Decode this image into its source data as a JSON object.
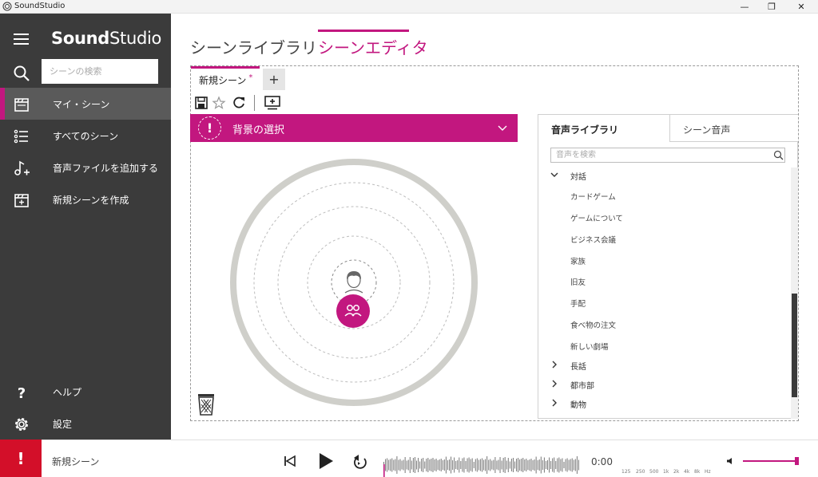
{
  "window": {
    "title": "SoundStudio",
    "controls": {
      "minimize": "—",
      "maximize": "❐",
      "close": "✕"
    }
  },
  "sidebar": {
    "brand_bold": "Sound",
    "brand_rest": "Studio",
    "search_placeholder": "シーンの検索",
    "items": [
      {
        "label": "マイ・シーン",
        "icon": "clapperboard-icon",
        "active": true
      },
      {
        "label": "すべてのシーン",
        "icon": "list-icon"
      },
      {
        "label": "音声ファイルを追加する",
        "icon": "add-music-icon"
      },
      {
        "label": "新規シーンを作成",
        "icon": "new-scene-icon"
      }
    ],
    "bottom_items": [
      {
        "label": "ヘルプ",
        "icon": "help-icon"
      },
      {
        "label": "設定",
        "icon": "gear-icon"
      }
    ]
  },
  "header": {
    "tabs": [
      {
        "label": "シーンライブラリ",
        "active": false
      },
      {
        "label": "シーンエディタ",
        "active": true
      }
    ]
  },
  "editor": {
    "doc_tab": {
      "label": "新規シーン",
      "dirty_marker": "*"
    },
    "add_tab_label": "+",
    "background_selector": {
      "warning_symbol": "!",
      "label": "背景の選択"
    }
  },
  "library": {
    "tabs": [
      {
        "label": "音声ライブラリ",
        "active": true
      },
      {
        "label": "シーン音声",
        "active": false
      }
    ],
    "search_placeholder": "音声を検索",
    "groups": [
      {
        "label": "対話",
        "expanded": true,
        "items": [
          "カードゲーム",
          "ゲームについて",
          "ビジネス会議",
          "家族",
          "旧友",
          "手配",
          "食べ物の注文",
          "新しい劇場"
        ]
      },
      {
        "label": "長話",
        "expanded": false
      },
      {
        "label": "都市部",
        "expanded": false
      },
      {
        "label": "動物",
        "expanded": false
      }
    ]
  },
  "player": {
    "alert_symbol": "!",
    "now_playing": "新規シーン",
    "time": "0:00",
    "freq_labels": [
      "125",
      "250",
      "500",
      "1k",
      "2k",
      "4k",
      "8k",
      "Hz"
    ],
    "volume": 0.97,
    "accent_color": "#c2177f",
    "alert_color": "#d30f29"
  }
}
